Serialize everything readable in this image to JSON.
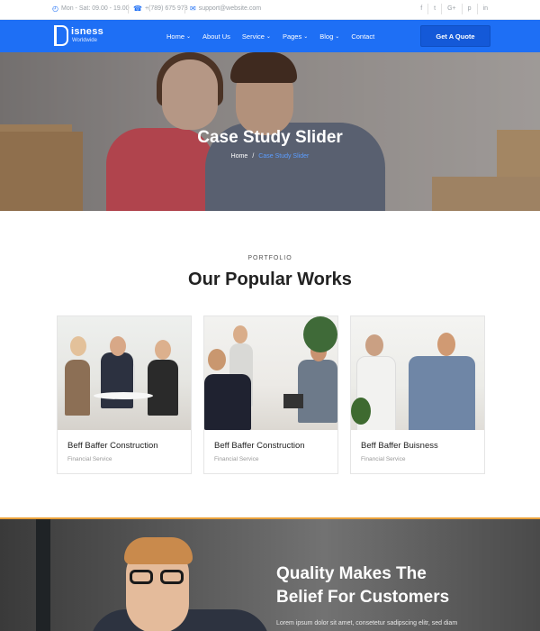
{
  "topbar": {
    "hours": "Mon - Sat: 09.00 - 19.00",
    "phone": "+(789) 675 978",
    "email": "support@website.com",
    "social": [
      "f",
      "t",
      "G+",
      "p",
      "in"
    ]
  },
  "brand": {
    "letter": "B",
    "name": "isness",
    "tagline": "Worldwide"
  },
  "nav": {
    "items": [
      {
        "label": "Home",
        "dropdown": true
      },
      {
        "label": "About Us",
        "dropdown": false
      },
      {
        "label": "Service",
        "dropdown": true
      },
      {
        "label": "Pages",
        "dropdown": true
      },
      {
        "label": "Blog",
        "dropdown": true
      },
      {
        "label": "Contact",
        "dropdown": false
      }
    ],
    "cta": "Get A Quote"
  },
  "hero": {
    "title": "Case Study Slider",
    "breadcrumb_home": "Home",
    "breadcrumb_sep": "/",
    "breadcrumb_current": "Case Study Slider"
  },
  "portfolio": {
    "kicker": "PORTFOLIO",
    "title": "Our Popular Works",
    "cards": [
      {
        "title": "Beff Baffer Construction",
        "subtitle": "Financial Service"
      },
      {
        "title": "Beff Baffer Construction",
        "subtitle": "Financial Service"
      },
      {
        "title": "Beff Baffer Buisness",
        "subtitle": "Financial Service"
      }
    ]
  },
  "quality": {
    "title_line1": "Quality Makes The",
    "title_line2": "Belief For Customers",
    "text": "Lorem ipsum dolor sit amet, consetetur sadipscing elitr, sed diam"
  },
  "colors": {
    "primary": "#1e6ff5",
    "accent": "#e9a13b"
  }
}
